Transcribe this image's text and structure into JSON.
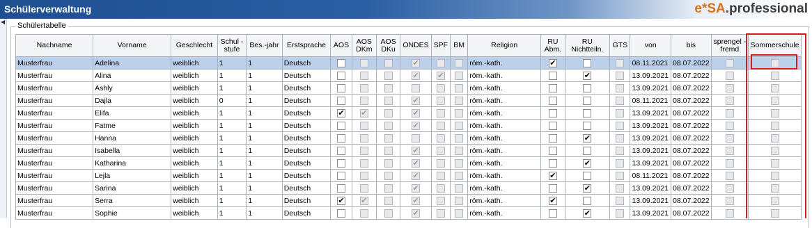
{
  "window": {
    "title": "Schülerverwaltung",
    "brand_prefix": "e*SA",
    "brand_dot": ".",
    "brand_suffix": "professional"
  },
  "table_section": {
    "legend": "Schülertabelle"
  },
  "columns": [
    {
      "key": "nachname",
      "label": "Nachname"
    },
    {
      "key": "vorname",
      "label": "Vorname"
    },
    {
      "key": "geschlecht",
      "label": "Geschlecht"
    },
    {
      "key": "schulstufe",
      "label": "Schul -stufe"
    },
    {
      "key": "besjahr",
      "label": "Bes.-jahr"
    },
    {
      "key": "erstsprache",
      "label": "Erstsprache"
    },
    {
      "key": "aos",
      "label": "AOS"
    },
    {
      "key": "aosdkm",
      "label": "AOS DKm"
    },
    {
      "key": "aosdku",
      "label": "AOS DKu"
    },
    {
      "key": "ondes",
      "label": "ONDES"
    },
    {
      "key": "spf",
      "label": "SPF"
    },
    {
      "key": "bm",
      "label": "BM"
    },
    {
      "key": "religion",
      "label": "Religion"
    },
    {
      "key": "ruabm",
      "label": "RU Abm."
    },
    {
      "key": "runicht",
      "label": "RU Nichtteiln."
    },
    {
      "key": "gts",
      "label": "GTS"
    },
    {
      "key": "von",
      "label": "von"
    },
    {
      "key": "bis",
      "label": "bis"
    },
    {
      "key": "sprengel",
      "label": "sprengel -fremd"
    },
    {
      "key": "sommerschule",
      "label": "Sommerschule"
    }
  ],
  "rows": [
    {
      "nachname": "Musterfrau",
      "vorname": "Adelina",
      "geschlecht": "weiblich",
      "schulstufe": "1",
      "besjahr": "1",
      "erstsprache": "Deutsch",
      "aos": false,
      "aosdkm": false,
      "aosdku": false,
      "ondes": true,
      "spf": false,
      "bm": false,
      "religion": "röm.-kath.",
      "ruabm": true,
      "runicht": false,
      "gts": false,
      "von": "08.11.2021",
      "bis": "08.07.2022",
      "sprengel": false,
      "sommerschule": false,
      "selected": true
    },
    {
      "nachname": "Musterfrau",
      "vorname": "Alina",
      "geschlecht": "weiblich",
      "schulstufe": "1",
      "besjahr": "1",
      "erstsprache": "Deutsch",
      "aos": false,
      "aosdkm": false,
      "aosdku": false,
      "ondes": true,
      "spf": true,
      "bm": false,
      "religion": "röm.-kath.",
      "ruabm": false,
      "runicht": true,
      "gts": false,
      "von": "13.09.2021",
      "bis": "08.07.2022",
      "sprengel": false,
      "sommerschule": false
    },
    {
      "nachname": "Musterfrau",
      "vorname": "Ashly",
      "geschlecht": "weiblich",
      "schulstufe": "1",
      "besjahr": "1",
      "erstsprache": "Deutsch",
      "aos": false,
      "aosdkm": false,
      "aosdku": false,
      "ondes": false,
      "spf": false,
      "bm": false,
      "religion": "röm.-kath.",
      "ruabm": false,
      "runicht": false,
      "gts": false,
      "von": "13.09.2021",
      "bis": "08.07.2022",
      "sprengel": false,
      "sommerschule": false
    },
    {
      "nachname": "Musterfrau",
      "vorname": "Dajla",
      "geschlecht": "weiblich",
      "schulstufe": "0",
      "besjahr": "1",
      "erstsprache": "Deutsch",
      "aos": false,
      "aosdkm": false,
      "aosdku": false,
      "ondes": true,
      "spf": false,
      "bm": false,
      "religion": "röm.-kath.",
      "ruabm": false,
      "runicht": false,
      "gts": false,
      "von": "08.11.2021",
      "bis": "08.07.2022",
      "sprengel": false,
      "sommerschule": false
    },
    {
      "nachname": "Musterfrau",
      "vorname": "Elifa",
      "geschlecht": "weiblich",
      "schulstufe": "1",
      "besjahr": "1",
      "erstsprache": "Deutsch",
      "aos": true,
      "aosdkm": true,
      "aosdku": false,
      "ondes": true,
      "spf": false,
      "bm": false,
      "religion": "röm.-kath.",
      "ruabm": false,
      "runicht": false,
      "gts": false,
      "von": "13.09.2021",
      "bis": "08.07.2022",
      "sprengel": false,
      "sommerschule": false
    },
    {
      "nachname": "Musterfrau",
      "vorname": "Fatme",
      "geschlecht": "weiblich",
      "schulstufe": "1",
      "besjahr": "1",
      "erstsprache": "Deutsch",
      "aos": false,
      "aosdkm": false,
      "aosdku": false,
      "ondes": true,
      "spf": false,
      "bm": false,
      "religion": "röm.-kath.",
      "ruabm": false,
      "runicht": false,
      "gts": false,
      "von": "13.09.2021",
      "bis": "08.07.2022",
      "sprengel": false,
      "sommerschule": false
    },
    {
      "nachname": "Musterfrau",
      "vorname": "Hanna",
      "geschlecht": "weiblich",
      "schulstufe": "1",
      "besjahr": "1",
      "erstsprache": "Deutsch",
      "aos": false,
      "aosdkm": false,
      "aosdku": false,
      "ondes": false,
      "spf": false,
      "bm": false,
      "religion": "röm.-kath.",
      "ruabm": false,
      "runicht": true,
      "gts": false,
      "von": "13.09.2021",
      "bis": "08.07.2022",
      "sprengel": false,
      "sommerschule": false
    },
    {
      "nachname": "Musterfrau",
      "vorname": "Isabella",
      "geschlecht": "weiblich",
      "schulstufe": "1",
      "besjahr": "1",
      "erstsprache": "Deutsch",
      "aos": false,
      "aosdkm": false,
      "aosdku": false,
      "ondes": true,
      "spf": false,
      "bm": false,
      "religion": "röm.-kath.",
      "ruabm": false,
      "runicht": false,
      "gts": false,
      "von": "13.09.2021",
      "bis": "08.07.2022",
      "sprengel": false,
      "sommerschule": false
    },
    {
      "nachname": "Musterfrau",
      "vorname": "Katharina",
      "geschlecht": "weiblich",
      "schulstufe": "1",
      "besjahr": "1",
      "erstsprache": "Deutsch",
      "aos": false,
      "aosdkm": false,
      "aosdku": false,
      "ondes": true,
      "spf": false,
      "bm": false,
      "religion": "röm.-kath.",
      "ruabm": false,
      "runicht": true,
      "gts": false,
      "von": "13.09.2021",
      "bis": "08.07.2022",
      "sprengel": false,
      "sommerschule": false
    },
    {
      "nachname": "Musterfrau",
      "vorname": "Lejla",
      "geschlecht": "weiblich",
      "schulstufe": "1",
      "besjahr": "1",
      "erstsprache": "Deutsch",
      "aos": false,
      "aosdkm": false,
      "aosdku": false,
      "ondes": true,
      "spf": false,
      "bm": false,
      "religion": "röm.-kath.",
      "ruabm": true,
      "runicht": false,
      "gts": false,
      "von": "08.11.2021",
      "bis": "08.07.2022",
      "sprengel": false,
      "sommerschule": false
    },
    {
      "nachname": "Musterfrau",
      "vorname": "Sarina",
      "geschlecht": "weiblich",
      "schulstufe": "1",
      "besjahr": "1",
      "erstsprache": "Deutsch",
      "aos": false,
      "aosdkm": false,
      "aosdku": false,
      "ondes": true,
      "spf": false,
      "bm": false,
      "religion": "röm.-kath.",
      "ruabm": false,
      "runicht": true,
      "gts": false,
      "von": "13.09.2021",
      "bis": "08.07.2022",
      "sprengel": false,
      "sommerschule": false
    },
    {
      "nachname": "Musterfrau",
      "vorname": "Serra",
      "geschlecht": "weiblich",
      "schulstufe": "1",
      "besjahr": "1",
      "erstsprache": "Deutsch",
      "aos": true,
      "aosdkm": true,
      "aosdku": false,
      "ondes": true,
      "spf": false,
      "bm": false,
      "religion": "röm.-kath.",
      "ruabm": true,
      "runicht": false,
      "gts": false,
      "von": "13.09.2021",
      "bis": "08.07.2022",
      "sprengel": false,
      "sommerschule": false
    },
    {
      "nachname": "Musterfrau",
      "vorname": "Sophie",
      "geschlecht": "weiblich",
      "schulstufe": "1",
      "besjahr": "1",
      "erstsprache": "Deutsch",
      "aos": false,
      "aosdkm": false,
      "aosdku": false,
      "ondes": true,
      "spf": false,
      "bm": false,
      "religion": "röm.-kath.",
      "ruabm": false,
      "runicht": true,
      "gts": false,
      "von": "13.09.2021",
      "bis": "08.07.2022",
      "sprengel": false,
      "sommerschule": false
    }
  ],
  "colors": {
    "title_bar": "#1d4f91",
    "selected_row": "#bcd0ec",
    "highlight_frame": "#d41e1e",
    "brand_accent": "#d7711b"
  }
}
